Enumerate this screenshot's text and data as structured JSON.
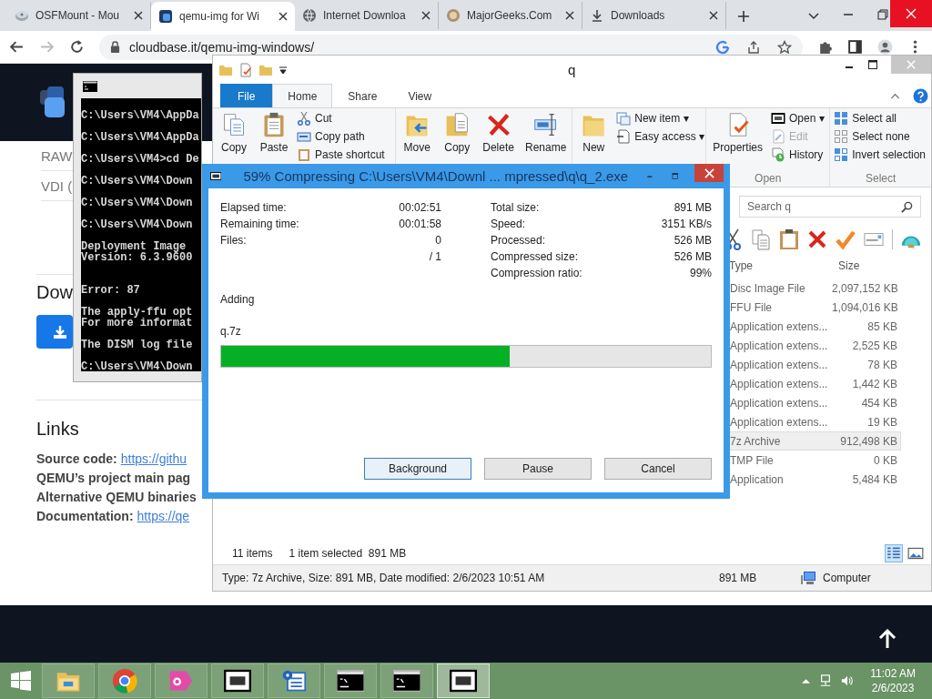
{
  "browser": {
    "tabs": [
      {
        "title": "OSFMount - Mou",
        "selected": false
      },
      {
        "title": "qemu-img for Wi",
        "selected": true
      },
      {
        "title": "Internet Downloa",
        "selected": false
      },
      {
        "title": "MajorGeeks.Com",
        "selected": false
      },
      {
        "title": "Downloads",
        "selected": false
      }
    ],
    "url": "cloudbase.it/qemu-img-windows/"
  },
  "web": {
    "nav_items": [
      "RAW",
      "VDI ("
    ],
    "heading": "Dow",
    "links_heading": "Links",
    "links": [
      {
        "label": "Source code:",
        "link": "https://githu"
      },
      {
        "label": "QEMU’s project main pag"
      },
      {
        "label": "Alternative QEMU binaries"
      },
      {
        "label": "Documentation:",
        "link": "https://qe"
      }
    ]
  },
  "console": {
    "blocks": [
      [
        "C:\\Users\\VM4\\AppDa"
      ],
      [
        "C:\\Users\\VM4\\AppDa"
      ],
      [
        "C:\\Users\\VM4>cd De"
      ],
      [
        "C:\\Users\\VM4\\Down"
      ],
      [
        "C:\\Users\\VM4\\Down"
      ],
      [
        "C:\\Users\\VM4\\Down"
      ],
      [
        "Deployment Image",
        "Version: 6.3.9600"
      ],
      [
        "Error: 87"
      ],
      [
        "The apply-ffu opt",
        "For more informat"
      ],
      [
        "The DISM log file"
      ],
      [
        "C:\\Users\\VM4\\Down"
      ]
    ]
  },
  "explorer": {
    "title": "q",
    "ribbon_tabs": [
      {
        "label": "File",
        "kind": "file",
        "selected": false
      },
      {
        "label": "Home",
        "kind": "tab",
        "selected": true
      },
      {
        "label": "Share",
        "kind": "tab",
        "selected": false
      },
      {
        "label": "View",
        "kind": "tab",
        "selected": false
      }
    ],
    "groups": [
      {
        "items": [
          {
            "kind": "large",
            "label": "Copy"
          },
          {
            "kind": "large",
            "label": "Paste"
          },
          {
            "kind": "stack",
            "items": [
              {
                "label": "Cut",
                "disabled": false
              },
              {
                "label": "Copy path",
                "disabled": false
              },
              {
                "label": "Paste shortcut",
                "disabled": false
              }
            ]
          }
        ]
      },
      {
        "items": [
          {
            "kind": "large",
            "label": "Move"
          },
          {
            "kind": "large",
            "label": "Copy"
          },
          {
            "kind": "large",
            "label": "Delete"
          },
          {
            "kind": "large",
            "label": "Rename"
          }
        ]
      },
      {
        "items": [
          {
            "kind": "large",
            "label": "New"
          },
          {
            "kind": "stack",
            "items": [
              {
                "label": "New item ▾",
                "disabled": false
              },
              {
                "label": "Easy access ▾",
                "disabled": false
              }
            ]
          }
        ]
      },
      {
        "label": "Open",
        "items": [
          {
            "kind": "large",
            "label": "Properties"
          },
          {
            "kind": "stack",
            "items": [
              {
                "label": "Open ▾",
                "disabled": false
              },
              {
                "label": "Edit",
                "disabled": true
              },
              {
                "label": "History",
                "disabled": false
              }
            ]
          }
        ]
      },
      {
        "label": "Select",
        "items": [
          {
            "kind": "stack",
            "items": [
              {
                "label": "Select all",
                "disabled": false
              },
              {
                "label": "Select none",
                "disabled": false
              },
              {
                "label": "Invert selection",
                "disabled": false
              }
            ]
          }
        ]
      }
    ],
    "search": {
      "placeholder": "Search q"
    },
    "columns": [
      "Type",
      "Size"
    ],
    "rows": [
      {
        "type": "Disc Image File",
        "size": "2,097,152 KB",
        "selected": false
      },
      {
        "type": "FFU File",
        "size": "1,094,016 KB",
        "selected": false
      },
      {
        "type": "Application extens...",
        "size": "85 KB",
        "selected": false
      },
      {
        "type": "Application extens...",
        "size": "2,525 KB",
        "selected": false
      },
      {
        "type": "Application extens...",
        "size": "78 KB",
        "selected": false
      },
      {
        "type": "Application extens...",
        "size": "1,442 KB",
        "selected": false
      },
      {
        "type": "Application extens...",
        "size": "454 KB",
        "selected": false
      },
      {
        "type": "Application extens...",
        "size": "19 KB",
        "selected": false
      },
      {
        "type": "7z Archive",
        "size": "912,498 KB",
        "selected": true
      },
      {
        "type": "TMP File",
        "size": "0 KB",
        "selected": false
      },
      {
        "type": "Application",
        "size": "5,484 KB",
        "selected": false
      }
    ],
    "item_count": "11 items",
    "selection": "1 item selected  891 MB",
    "details": {
      "info": "Type: 7z Archive, Size: 891 MB, Date modified: 2/6/2023 10:51 AM",
      "size": "891 MB",
      "location": "Computer"
    }
  },
  "dialog": {
    "title": "59% Compressing C:\\Users\\VM4\\Downl ... mpressed\\q\\q_2.exe",
    "left": [
      {
        "label": "Elapsed time:",
        "value": "00:02:51"
      },
      {
        "label": "Remaining time:",
        "value": "00:01:58"
      },
      {
        "label": "Files:",
        "value": "0"
      },
      {
        "value": "/ 1"
      }
    ],
    "right": [
      {
        "label": "Total size:",
        "value": "891 MB"
      },
      {
        "label": "Speed:",
        "value": "3151 KB/s"
      },
      {
        "label": "Processed:",
        "value": "526 MB"
      },
      {
        "label": "Compressed size:",
        "value": "526 MB"
      },
      {
        "label": "Compression ratio:",
        "value": "99%"
      }
    ],
    "action": "Adding",
    "file": "q.7z",
    "level": 0.59,
    "buttons": [
      {
        "label": "Background",
        "focused": true
      },
      {
        "label": "Pause",
        "focused": false
      },
      {
        "label": "Cancel",
        "focused": false
      }
    ]
  },
  "taskbar": {
    "apps": [
      {
        "kind": "explorer",
        "active": false
      },
      {
        "kind": "chrome",
        "active": false
      },
      {
        "kind": "ds",
        "active": false
      },
      {
        "kind": "sevenzip",
        "active": false
      },
      {
        "kind": "tool",
        "active": false
      },
      {
        "kind": "console",
        "active": false
      },
      {
        "kind": "console",
        "active": false
      },
      {
        "kind": "sevenzip",
        "active": true
      }
    ],
    "time": "11:02 AM",
    "date": "2/6/2023"
  }
}
